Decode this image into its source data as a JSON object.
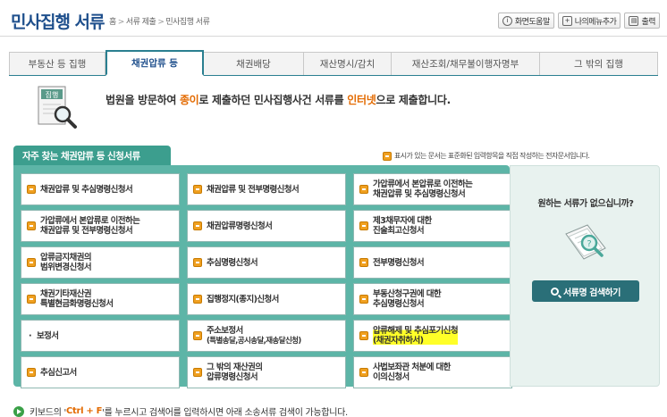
{
  "header": {
    "title": "민사집행 서류",
    "breadcrumb": [
      "홈",
      "서류 제출",
      "민사집행 서류"
    ],
    "buttons": {
      "help": "화면도움말",
      "add_menu": "나의메뉴추가",
      "print": "출력"
    }
  },
  "tabs": [
    {
      "label": "부동산 등 집행",
      "active": false
    },
    {
      "label": "채권압류 등",
      "active": true
    },
    {
      "label": "채권배당",
      "active": false
    },
    {
      "label": "재산명시/감치",
      "active": false
    },
    {
      "label": "재산조회/채무불이행자명부",
      "active": false
    },
    {
      "label": "그 밖의 집행",
      "active": false
    }
  ],
  "intro": {
    "icon_label": "집행",
    "text_before": "법원을 방문하여 ",
    "text_hl1": "종이",
    "text_mid": "로 제출하던 민사집행사건 서류를 ",
    "text_hl2": "인터넷",
    "text_after": "으로 제출합니다."
  },
  "panel": {
    "title": "자주 찾는 채권압류 등 신청서류",
    "legend": "표시가 있는 문서는 표준화된 입력항목을 직접 작성하는 전자문서입니다."
  },
  "documents": [
    {
      "label": "채권압류 및 추심명령신청서",
      "electronic": true
    },
    {
      "label": "채권압류 및 전부명령신청서",
      "electronic": true
    },
    {
      "label": "가압류에서 본압류로 이전하는\n채권압류 및 추심명령신청서",
      "electronic": true
    },
    {
      "label": "가압류에서 본압류로 이전하는\n채권압류 및 전부명령신청서",
      "electronic": true
    },
    {
      "label": "채권압류명령신청서",
      "electronic": true
    },
    {
      "label": "제3채무자에 대한\n진술최고신청서",
      "electronic": true
    },
    {
      "label": "압류금지채권의\n범위변경신청서",
      "electronic": true
    },
    {
      "label": "추심명령신청서",
      "electronic": true
    },
    {
      "label": "전부명령신청서",
      "electronic": true
    },
    {
      "label": "채권기타재산권\n특별현금화명령신청서",
      "electronic": true
    },
    {
      "label": "집행정지(종지)신청서",
      "electronic": true
    },
    {
      "label": "부동산청구권에 대한\n추심명령신청서",
      "electronic": true
    },
    {
      "label": "보정서",
      "electronic": false
    },
    {
      "label": "주소보정서",
      "sub": "(특별송달,공시송달,재송달신청)",
      "electronic": true
    },
    {
      "label": "압류해제 및 추심포기신청\n(채권자취하서)",
      "electronic": true,
      "highlighted": true
    },
    {
      "label": "추심신고서",
      "electronic": true
    },
    {
      "label": "그 밖의 재산권의\n압류명령신청서",
      "electronic": true
    },
    {
      "label": "사법보좌관 처분에 대한\n이의신청서",
      "electronic": true
    }
  ],
  "side": {
    "question": "원하는 서류가 없으십니까?",
    "button": "서류명 검색하기"
  },
  "footer": {
    "before": "키보드의 '",
    "key": "Ctrl + F",
    "after": "'를 누르시고 검색어를 입력하시면 아래 소송서류 검색이 가능합니다."
  },
  "colors": {
    "accent": "#2a7f90",
    "panel": "#5db5a7",
    "title": "#1e4f8c",
    "highlight": "#ffff28",
    "doc_icon": "#f0a020"
  }
}
